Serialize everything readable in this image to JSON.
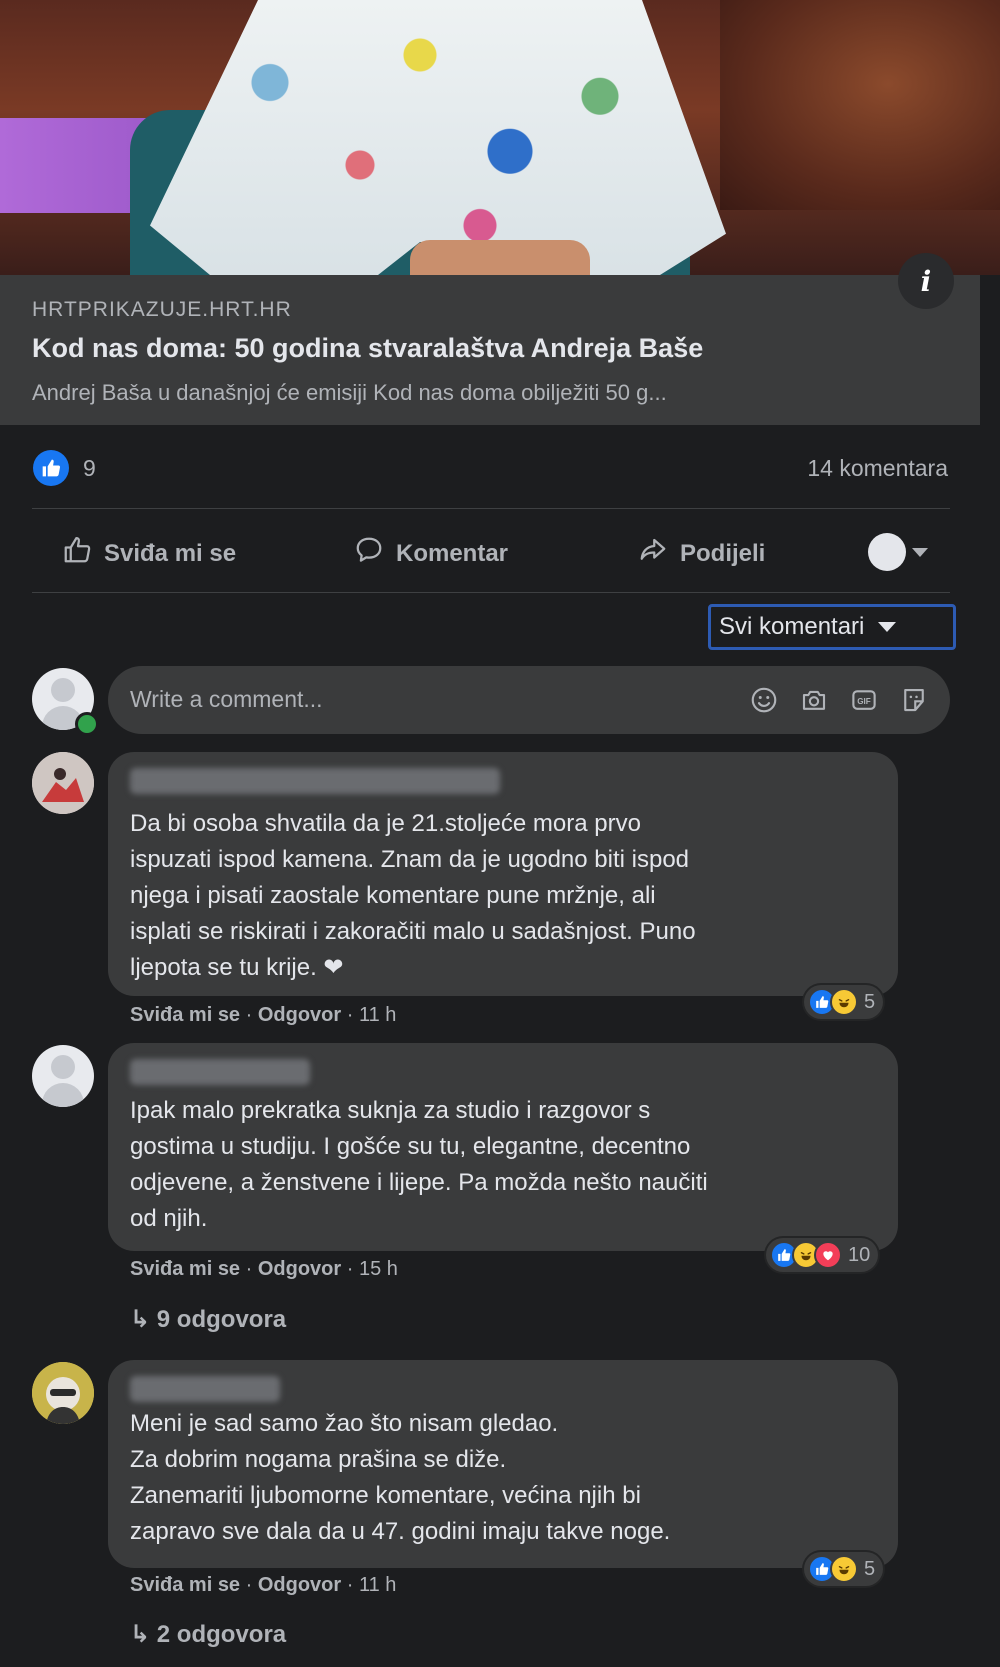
{
  "link": {
    "domain": "HRTPRIKAZUJE.HRT.HR",
    "title": "Kod nas doma: 50 godina stvaralaštva Andreja Baše",
    "description": "Andrej Baša u današnjoj će emisiji Kod nas doma obilježiti 50 g..."
  },
  "stats": {
    "likes": "9",
    "comments": "14 komentara"
  },
  "actions": {
    "like": "Sviđa mi se",
    "comment": "Komentar",
    "share": "Podijeli"
  },
  "sort": {
    "label": "Svi komentari"
  },
  "composer": {
    "placeholder": "Write a comment..."
  },
  "comments": [
    {
      "text": "Da bi osoba shvatila da je 21.stoljeće mora prvo\nispuzati ispod kamena. Znam da je ugodno biti ispod\nnjega i pisati zaostale komentare pune mržnje, ali\nisplati se riskirati i zakoračiti malo u sadašnjost. Puno\nljepota se tu krije. ❤",
      "like_label": "Sviđa mi se",
      "reply_label": "Odgovor",
      "time": "11 h",
      "reactions_count": "5"
    },
    {
      "text": "Ipak malo prekratka suknja za studio i razgovor s\ngostima u studiju. I gošće su tu, elegantne, decentno\nodjevene, a ženstvene i lijepe. Pa možda nešto naučiti\nod njih.",
      "like_label": "Sviđa mi se",
      "reply_label": "Odgovor",
      "time": "15 h",
      "reactions_count": "10",
      "replies": "9 odgovora"
    },
    {
      "text": "Meni je sad samo žao što nisam gledao.\nZa dobrim nogama prašina se diže.\nZanemariti ljubomorne komentare, većina njih bi\nzapravo sve dala da u 47. godini imaju takve noge.",
      "like_label": "Sviđa mi se",
      "reply_label": "Odgovor",
      "time": "11 h",
      "reactions_count": "5",
      "replies": "2 odgovora"
    }
  ],
  "icons": {
    "info": "info-icon",
    "like": "thumbs-up-icon",
    "comment": "speech-bubble-icon",
    "share": "share-arrow-icon",
    "emoji": "smiley-icon",
    "camera": "camera-icon",
    "gif": "gif-icon",
    "sticker": "sticker-icon"
  },
  "colors": {
    "accent": "#1877f2",
    "focus_border": "#2d5bb3",
    "online": "#31a24c"
  }
}
